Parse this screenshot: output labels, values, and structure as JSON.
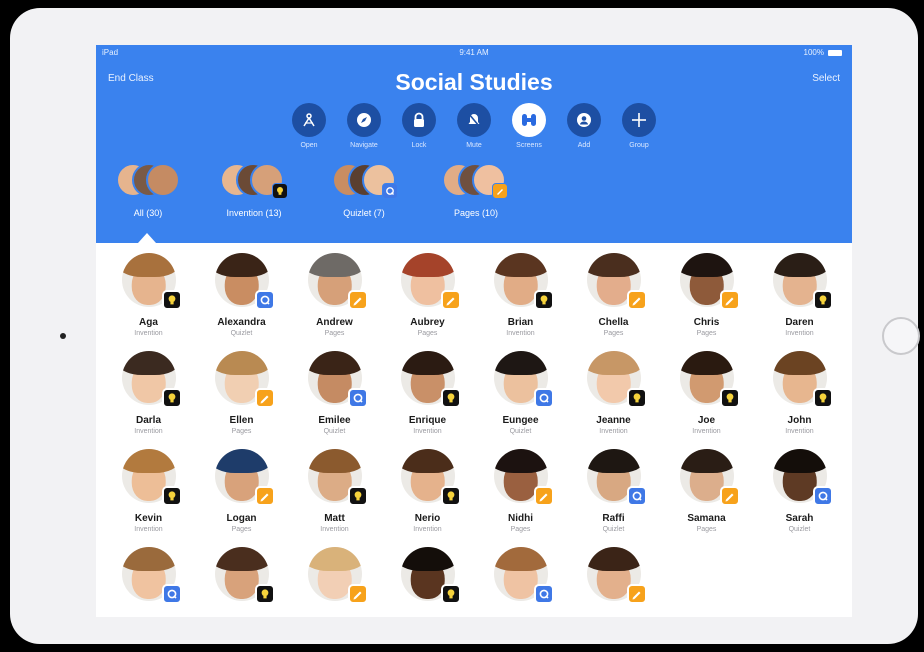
{
  "status_bar": {
    "carrier": "iPad",
    "time": "9:41 AM",
    "battery": "100%"
  },
  "header": {
    "title": "Social Studies",
    "end_class_label": "End Class",
    "select_label": "Select"
  },
  "toolbar": [
    {
      "label": "Open",
      "icon": "compass-rose-icon"
    },
    {
      "label": "Navigate",
      "icon": "navigate-compass-icon"
    },
    {
      "label": "Lock",
      "icon": "lock-icon"
    },
    {
      "label": "Mute",
      "icon": "mute-icon"
    },
    {
      "label": "Screens",
      "icon": "binoculars-icon",
      "active": true
    },
    {
      "label": "Add",
      "icon": "add-person-icon"
    },
    {
      "label": "Group",
      "icon": "plus-icon"
    }
  ],
  "groups": [
    {
      "label": "All (30)",
      "badge": "none",
      "selected": true
    },
    {
      "label": "Invention (13)",
      "badge": "invention"
    },
    {
      "label": "Quizlet (7)",
      "badge": "quizlet"
    },
    {
      "label": "Pages (10)",
      "badge": "pages"
    }
  ],
  "app_labels": {
    "invention": "Invention",
    "quizlet": "Quizlet",
    "pages": "Pages"
  },
  "students": [
    {
      "name": "Aga",
      "app": "Invention",
      "badge": "invention",
      "skin": "#e6b48e",
      "hair": "#a8713d"
    },
    {
      "name": "Alexandra",
      "app": "Quizlet",
      "badge": "quizlet",
      "skin": "#c98d62",
      "hair": "#3a2417"
    },
    {
      "name": "Andrew",
      "app": "Pages",
      "badge": "pages",
      "skin": "#d6a079",
      "hair": "#6e6a66"
    },
    {
      "name": "Aubrey",
      "app": "Pages",
      "badge": "pages",
      "skin": "#efc0a0",
      "hair": "#a5432a"
    },
    {
      "name": "Brian",
      "app": "Invention",
      "badge": "invention",
      "skin": "#e1ac86",
      "hair": "#5a3520"
    },
    {
      "name": "Chella",
      "app": "Pages",
      "badge": "pages",
      "skin": "#e3ad8c",
      "hair": "#4a2e1e"
    },
    {
      "name": "Chris",
      "app": "Pages",
      "badge": "pages",
      "skin": "#8e5a3a",
      "hair": "#1e1410"
    },
    {
      "name": "Daren",
      "app": "Invention",
      "badge": "invention",
      "skin": "#e4b38f",
      "hair": "#2a1e16"
    },
    {
      "name": "Darla",
      "app": "Invention",
      "badge": "invention",
      "skin": "#f0c7a6",
      "hair": "#3b2a20"
    },
    {
      "name": "Ellen",
      "app": "Pages",
      "badge": "pages",
      "skin": "#f1cfb2",
      "hair": "#b98a52"
    },
    {
      "name": "Emilee",
      "app": "Quizlet",
      "badge": "quizlet",
      "skin": "#c58b63",
      "hair": "#3a2417"
    },
    {
      "name": "Enrique",
      "app": "Invention",
      "badge": "invention",
      "skin": "#c99068",
      "hair": "#2b1b12"
    },
    {
      "name": "Eungee",
      "app": "Quizlet",
      "badge": "quizlet",
      "skin": "#ecc19e",
      "hair": "#1e1714"
    },
    {
      "name": "Jeanne",
      "app": "Invention",
      "badge": "invention",
      "skin": "#f2c9ab",
      "hair": "#c79766"
    },
    {
      "name": "Joe",
      "app": "Invention",
      "badge": "invention",
      "skin": "#d19a70",
      "hair": "#2a1a10"
    },
    {
      "name": "John",
      "app": "Invention",
      "badge": "invention",
      "skin": "#e7b68f",
      "hair": "#6b4322"
    },
    {
      "name": "Kevin",
      "app": "Invention",
      "badge": "invention",
      "skin": "#edbe97",
      "hair": "#b27a3e"
    },
    {
      "name": "Logan",
      "app": "Pages",
      "badge": "pages",
      "skin": "#d8a27b",
      "hair": "#1e3c6a"
    },
    {
      "name": "Matt",
      "app": "Invention",
      "badge": "invention",
      "skin": "#dcac86",
      "hair": "#8b5a2e"
    },
    {
      "name": "Nerio",
      "app": "Invention",
      "badge": "invention",
      "skin": "#e5b28c",
      "hair": "#4b2d1a"
    },
    {
      "name": "Nidhi",
      "app": "Pages",
      "badge": "pages",
      "skin": "#9a6040",
      "hair": "#1c1210"
    },
    {
      "name": "Raffi",
      "app": "Quizlet",
      "badge": "quizlet",
      "skin": "#d8a882",
      "hair": "#1e1712"
    },
    {
      "name": "Samana",
      "app": "Pages",
      "badge": "pages",
      "skin": "#dcae8c",
      "hair": "#2a1d15"
    },
    {
      "name": "Sarah",
      "app": "Quizlet",
      "badge": "quizlet",
      "skin": "#5e3a24",
      "hair": "#140e0a"
    },
    {
      "name": "",
      "app": "",
      "badge": "quizlet",
      "skin": "#f0c3a0",
      "hair": "#9a6a3c"
    },
    {
      "name": "",
      "app": "",
      "badge": "invention",
      "skin": "#d8a27b",
      "hair": "#4a2e1e"
    },
    {
      "name": "",
      "app": "",
      "badge": "pages",
      "skin": "#f2cfb5",
      "hair": "#d9b27a"
    },
    {
      "name": "",
      "app": "",
      "badge": "invention",
      "skin": "#5a3520",
      "hair": "#140e0a"
    },
    {
      "name": "",
      "app": "",
      "badge": "quizlet",
      "skin": "#efc3a3",
      "hair": "#a26a3c"
    },
    {
      "name": "",
      "app": "",
      "badge": "pages",
      "skin": "#e3b08c",
      "hair": "#3b2417"
    }
  ],
  "colors": {
    "header_blue": "#3a82ee",
    "pages_orange": "#f7a21b",
    "quizlet_blue": "#3f78e6",
    "invention_black": "#111111"
  }
}
